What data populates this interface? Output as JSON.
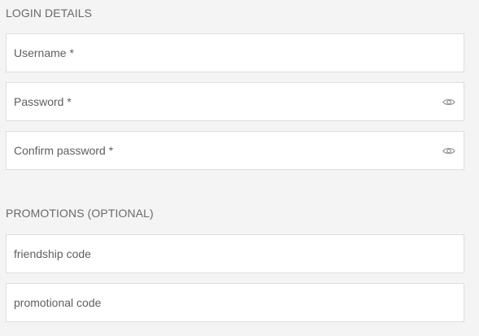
{
  "login": {
    "title": "LOGIN DETAILS",
    "username": {
      "value": "",
      "placeholder": "Username *"
    },
    "password": {
      "value": "",
      "placeholder": "Password *",
      "icon": "eye-icon"
    },
    "confirm_password": {
      "value": "",
      "placeholder": "Confirm password *",
      "icon": "eye-icon"
    }
  },
  "promotions": {
    "title": "PROMOTIONS (OPTIONAL)",
    "friendship_code": {
      "value": "",
      "placeholder": "friendship code"
    },
    "promotional_code": {
      "value": "",
      "placeholder": "promotional code"
    }
  },
  "colors": {
    "background": "#f4f4f4",
    "field_background": "#ffffff",
    "field_border": "#dddddd",
    "heading_text": "#6a6a6a",
    "placeholder_text": "#5f5f5f",
    "icon": "#9a9a9a"
  }
}
